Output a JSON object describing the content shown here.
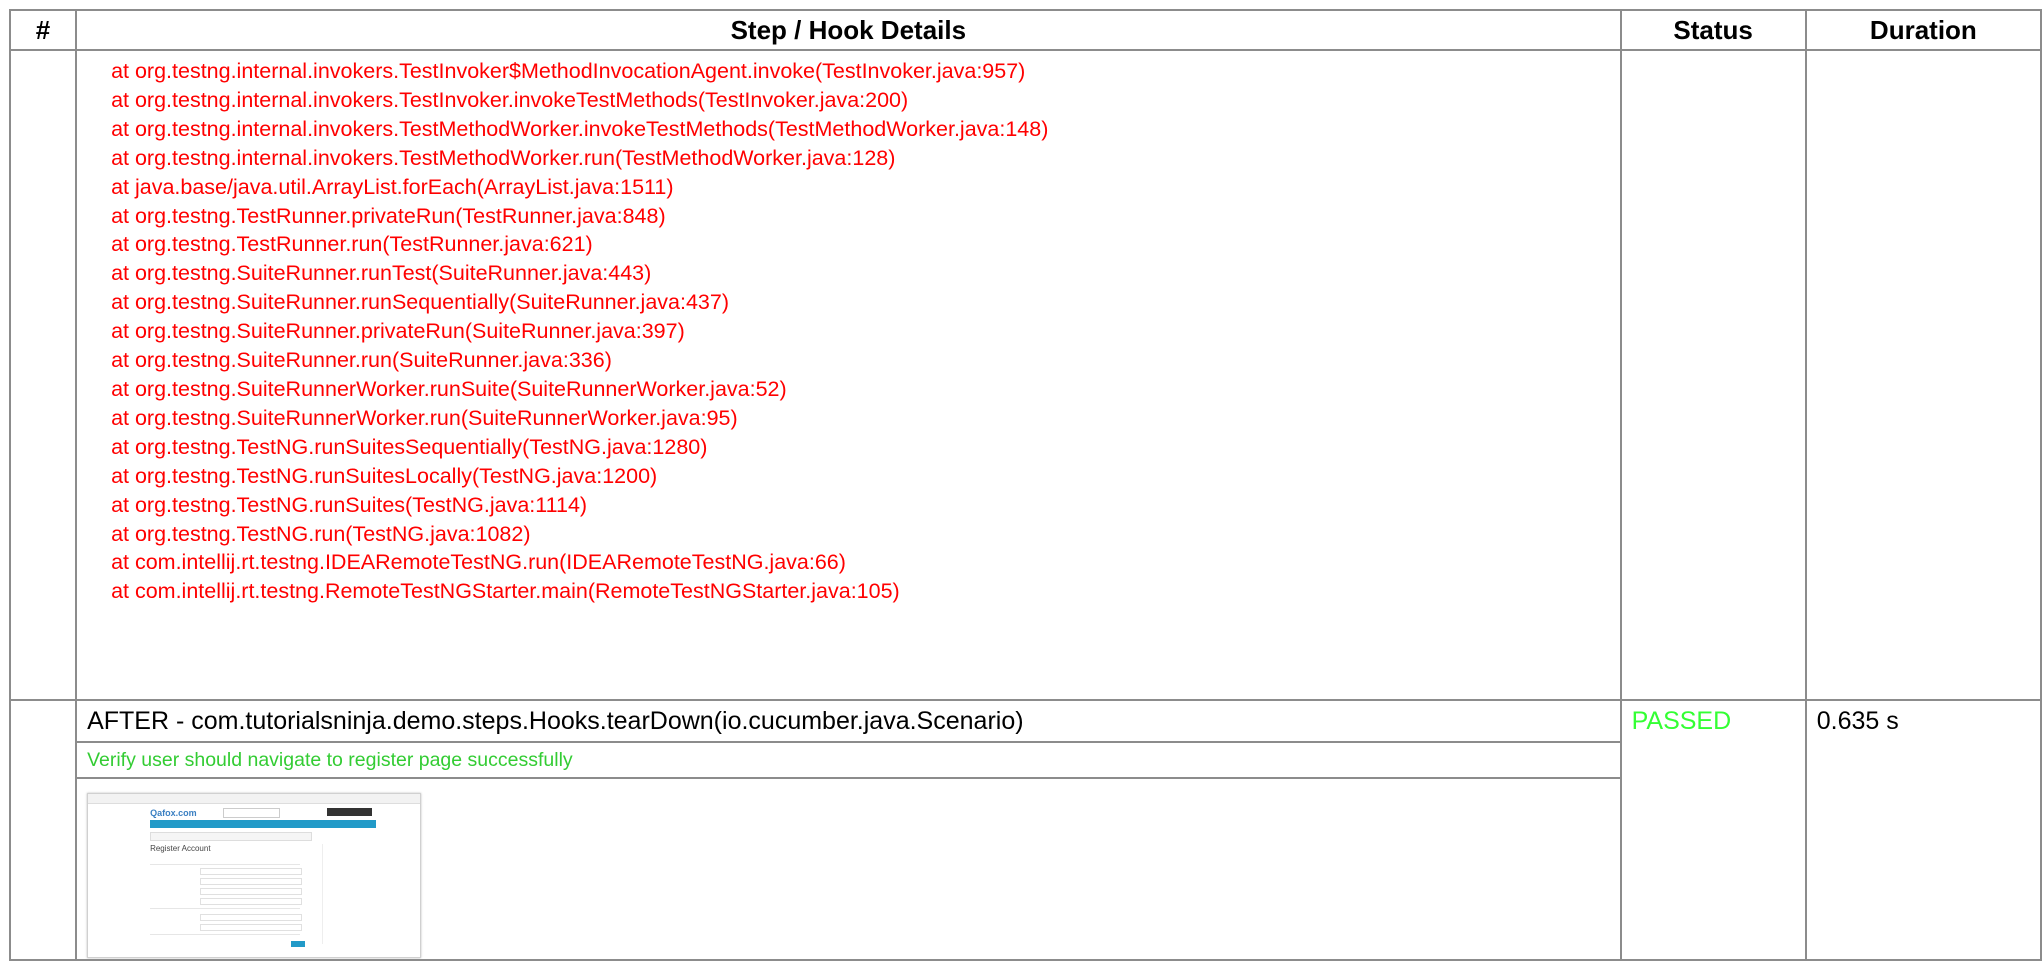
{
  "table": {
    "headers": {
      "num": "#",
      "step": "Step / Hook Details",
      "status": "Status",
      "duration": "Duration"
    }
  },
  "stack_trace": [
    "at org.testng.internal.invokers.TestInvoker$MethodInvocationAgent.invoke(TestInvoker.java:957)",
    "at org.testng.internal.invokers.TestInvoker.invokeTestMethods(TestInvoker.java:200)",
    "at org.testng.internal.invokers.TestMethodWorker.invokeTestMethods(TestMethodWorker.java:148)",
    "at org.testng.internal.invokers.TestMethodWorker.run(TestMethodWorker.java:128)",
    "at java.base/java.util.ArrayList.forEach(ArrayList.java:1511)",
    "at org.testng.TestRunner.privateRun(TestRunner.java:848)",
    "at org.testng.TestRunner.run(TestRunner.java:621)",
    "at org.testng.SuiteRunner.runTest(SuiteRunner.java:443)",
    "at org.testng.SuiteRunner.runSequentially(SuiteRunner.java:437)",
    "at org.testng.SuiteRunner.privateRun(SuiteRunner.java:397)",
    "at org.testng.SuiteRunner.run(SuiteRunner.java:336)",
    "at org.testng.SuiteRunnerWorker.runSuite(SuiteRunnerWorker.java:52)",
    "at org.testng.SuiteRunnerWorker.run(SuiteRunnerWorker.java:95)",
    "at org.testng.TestNG.runSuitesSequentially(TestNG.java:1280)",
    "at org.testng.TestNG.runSuitesLocally(TestNG.java:1200)",
    "at org.testng.TestNG.runSuites(TestNG.java:1114)",
    "at org.testng.TestNG.run(TestNG.java:1082)",
    "at com.intellij.rt.testng.IDEARemoteTestNG.run(IDEARemoteTestNG.java:66)",
    "at com.intellij.rt.testng.RemoteTestNGStarter.main(RemoteTestNGStarter.java:105)"
  ],
  "hook": {
    "title": "AFTER - com.tutorialsninja.demo.steps.Hooks.tearDown(io.cucumber.java.Scenario)",
    "description": "Verify user should navigate to register page successfully",
    "status": "PASSED",
    "duration": "0.635 s"
  },
  "screenshot_thumb": {
    "logo": "Qafox.com",
    "heading": "Register Account"
  },
  "colors": {
    "trace_text": "#ff0000",
    "passed_text": "#33ff33",
    "description_text": "#33cc33",
    "border": "#8c8c8c"
  }
}
